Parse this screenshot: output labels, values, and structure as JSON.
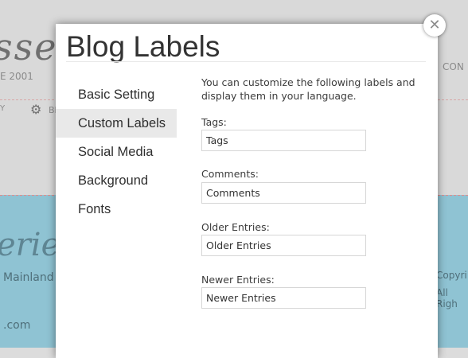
{
  "background": {
    "logo_text": "sse",
    "year_text": "E 2001",
    "con_text": "CON",
    "y_text": "Y",
    "b_text": "Bl",
    "script_text": "erie",
    "mainland_text": "Mainland",
    "com_text": ".com",
    "copy1_text": "Copyri",
    "copy2_text": "All Righ"
  },
  "modal": {
    "title": "Blog Labels",
    "close_symbol": "✕"
  },
  "nav": {
    "items": [
      {
        "label": "Basic Setting"
      },
      {
        "label": "Custom Labels"
      },
      {
        "label": "Social Media"
      },
      {
        "label": "Background"
      },
      {
        "label": "Fonts"
      }
    ]
  },
  "content": {
    "intro": "You can customize the following labels and display them in your language.",
    "fields": [
      {
        "label": "Tags:",
        "value": "Tags"
      },
      {
        "label": "Comments:",
        "value": "Comments"
      },
      {
        "label": "Older Entries:",
        "value": "Older Entries"
      },
      {
        "label": "Newer Entries:",
        "value": "Newer Entries"
      }
    ]
  }
}
